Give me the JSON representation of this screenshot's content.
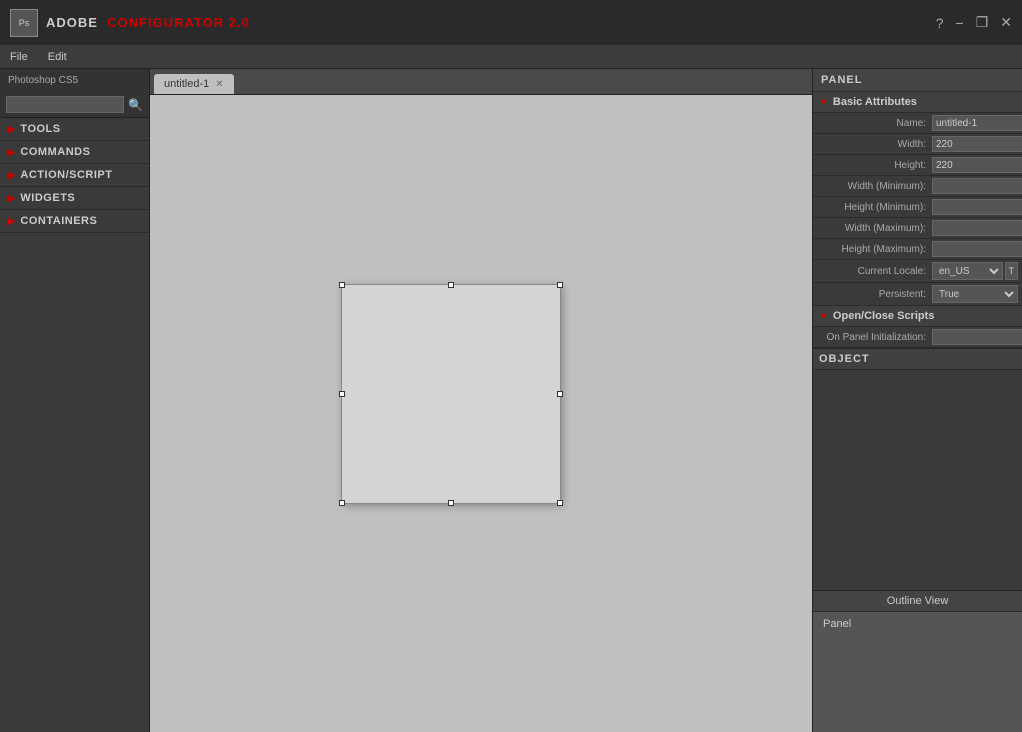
{
  "titlebar": {
    "logo_text": "Ps",
    "app_name_adobe": "ADOBE",
    "app_name_product": "CONFIGURATOR 2.0",
    "help_icon": "?",
    "minimize_icon": "−",
    "restore_icon": "❐",
    "close_icon": "✕"
  },
  "menubar": {
    "file_label": "File",
    "edit_label": "Edit"
  },
  "sidebar": {
    "photoshop_version": "Photoshop CS5",
    "search_placeholder": "",
    "sections": [
      {
        "id": "tools",
        "label": "TOOLS"
      },
      {
        "id": "commands",
        "label": "COMMANDS"
      },
      {
        "id": "action_script",
        "label": "ACTION/SCRIPT"
      },
      {
        "id": "widgets",
        "label": "WIDGETS"
      },
      {
        "id": "containers",
        "label": "CONTAINERS"
      }
    ]
  },
  "canvas": {
    "tab_name": "untitled-1",
    "tab_close": "✕"
  },
  "right_panel": {
    "header": "PANEL",
    "basic_attributes_title": "Basic Attributes",
    "open_close_scripts_title": "Open/Close Scripts",
    "object_label": "OBJECT",
    "attributes": {
      "name_label": "Name:",
      "name_value": "untitled-1",
      "width_label": "Width:",
      "width_value": "220",
      "height_label": "Height:",
      "height_value": "220",
      "width_min_label": "Width (Minimum):",
      "width_min_value": "",
      "height_min_label": "Height (Minimum):",
      "height_min_value": "",
      "width_max_label": "Width (Maximum):",
      "width_max_value": "",
      "height_max_label": "Height (Maximum):",
      "height_max_value": "",
      "current_locale_label": "Current Locale:",
      "current_locale_value": "en_US",
      "persistent_label": "Persistent:",
      "persistent_value": "True"
    },
    "scripts": {
      "on_panel_init_label": "On Panel Initialization:",
      "on_panel_init_value": ""
    },
    "outline": {
      "header": "Outline View",
      "panel_item": "Panel"
    }
  }
}
